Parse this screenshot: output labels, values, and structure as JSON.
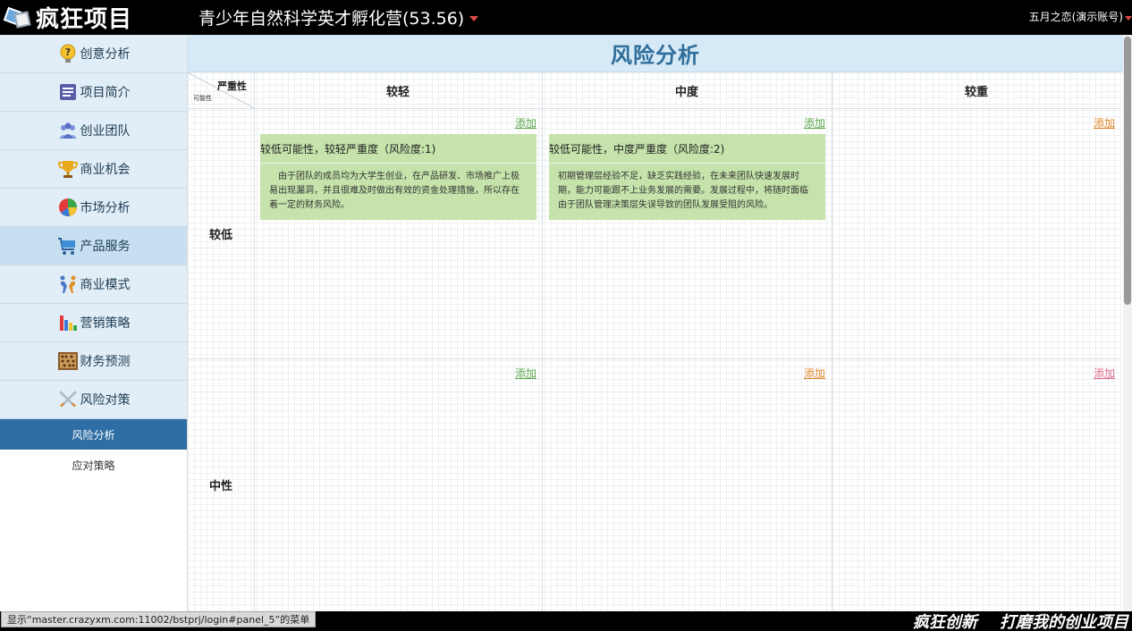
{
  "header": {
    "logo_text": "疯狂项目",
    "project_title": "青少年自然科学英才孵化营(53.56)",
    "user_name": "五月之恋(演示账号)"
  },
  "sidebar": {
    "items": [
      {
        "label": "创意分析",
        "icon": "lightbulb-question-icon"
      },
      {
        "label": "项目简介",
        "icon": "document-list-icon"
      },
      {
        "label": "创业团队",
        "icon": "team-people-icon"
      },
      {
        "label": "商业机会",
        "icon": "trophy-icon"
      },
      {
        "label": "市场分析",
        "icon": "pie-chart-icon"
      },
      {
        "label": "产品服务",
        "icon": "shopping-cart-icon"
      },
      {
        "label": "商业模式",
        "icon": "handshake-icon"
      },
      {
        "label": "营销策略",
        "icon": "bar-chart-icon"
      },
      {
        "label": "财务预测",
        "icon": "abacus-icon"
      },
      {
        "label": "风险对策",
        "icon": "crossed-swords-icon"
      }
    ],
    "sub_items": [
      {
        "label": "风险分析",
        "active": true
      },
      {
        "label": "应对策略",
        "active": false
      }
    ]
  },
  "main": {
    "title": "风险分析",
    "corner": {
      "severity": "严重性",
      "possibility": "可能性"
    },
    "columns": [
      "较轻",
      "中度",
      "较重"
    ],
    "rows": [
      "较低",
      "中性"
    ],
    "add_label": "添加",
    "cards": [
      {
        "title": "较低可能性，较轻严重度（风险度:1)",
        "body": "由于团队的成员均为大学生创业，在产品研发、市场推广上极易出现漏洞，并且很难及时做出有效的资金处理措施，所以存在着一定的财务风险。"
      },
      {
        "title": "较低可能性，中度严重度（风险度:2)",
        "body": "初期管理层经验不足，缺乏实践经验，在未来团队快速发展时期，能力可能跟不上业务发展的需要。发展过程中，将随时面临由于团队管理决策层失误导致的团队发展受阻的风险。"
      }
    ]
  },
  "status_tip": "显示“master.crazyxm.com:11002/bstprj/login#panel_5”的菜单",
  "slogan": "疯狂创新    打磨我的创业项目",
  "colors": {
    "accent": "#2f6ea5",
    "card_green": "#c5e3ab",
    "add_green": "#5aa84a",
    "add_orange": "#e08a2a",
    "add_pink": "#e06a8a"
  }
}
